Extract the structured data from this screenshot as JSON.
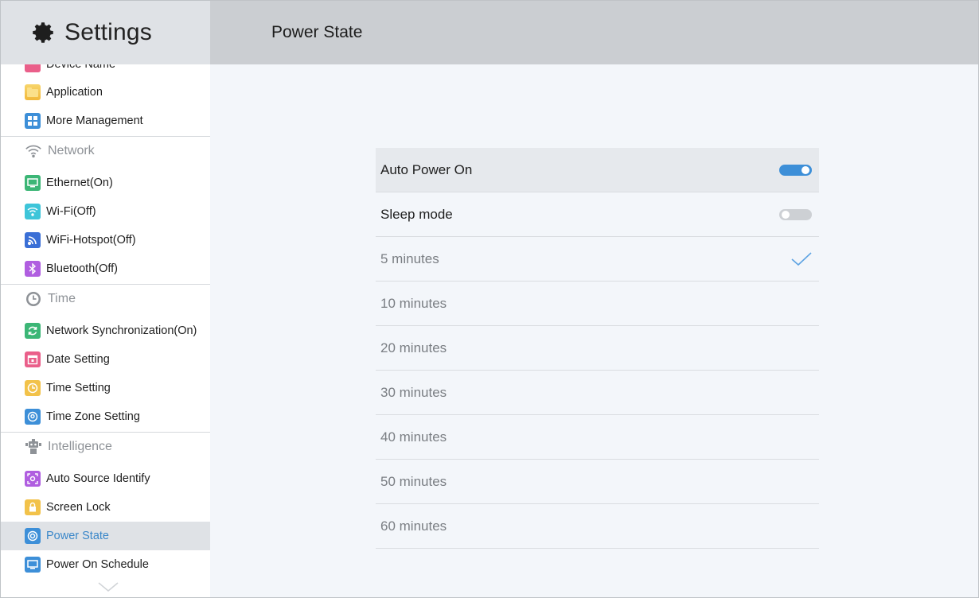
{
  "header": {
    "app_title": "Settings",
    "page_title": "Power State"
  },
  "sidebar": {
    "partial_item": {
      "label": "Device Name"
    },
    "items_top": [
      {
        "label": "Application",
        "icon": "folder-icon"
      },
      {
        "label": "More Management",
        "icon": "grid-icon"
      }
    ],
    "sections": {
      "network": "Network",
      "time": "Time",
      "intelligence": "Intelligence"
    },
    "network_items": [
      {
        "label": "Ethernet(On)",
        "icon": "monitor-icon"
      },
      {
        "label": "Wi-Fi(Off)",
        "icon": "wifi-icon"
      },
      {
        "label": "WiFi-Hotspot(Off)",
        "icon": "hotspot-icon"
      },
      {
        "label": "Bluetooth(Off)",
        "icon": "bluetooth-icon"
      }
    ],
    "time_items": [
      {
        "label": "Network Synchronization(On)",
        "icon": "sync-icon"
      },
      {
        "label": "Date Setting",
        "icon": "calendar-icon"
      },
      {
        "label": "Time Setting",
        "icon": "clock-icon"
      },
      {
        "label": "Time Zone Setting",
        "icon": "globe-icon"
      }
    ],
    "intelligence_items": [
      {
        "label": "Auto Source Identify",
        "icon": "source-icon"
      },
      {
        "label": "Screen Lock",
        "icon": "lock-icon"
      },
      {
        "label": "Power State",
        "icon": "power-icon",
        "active": true
      },
      {
        "label": "Power On Schedule",
        "icon": "schedule-icon"
      }
    ]
  },
  "content": {
    "auto_power_on": {
      "label": "Auto Power On",
      "enabled": true
    },
    "sleep_mode": {
      "label": "Sleep mode",
      "enabled": false
    },
    "options": [
      {
        "label": "5 minutes",
        "selected": true
      },
      {
        "label": "10 minutes",
        "selected": false
      },
      {
        "label": "20 minutes",
        "selected": false
      },
      {
        "label": "30 minutes",
        "selected": false
      },
      {
        "label": "40 minutes",
        "selected": false
      },
      {
        "label": "50 minutes",
        "selected": false
      },
      {
        "label": "60 minutes",
        "selected": false
      }
    ]
  },
  "colors": {
    "accent": "#3d8fd8",
    "header_left": "#dfe2e6",
    "header_right": "#cbced2",
    "content_bg": "#f3f6fa"
  }
}
